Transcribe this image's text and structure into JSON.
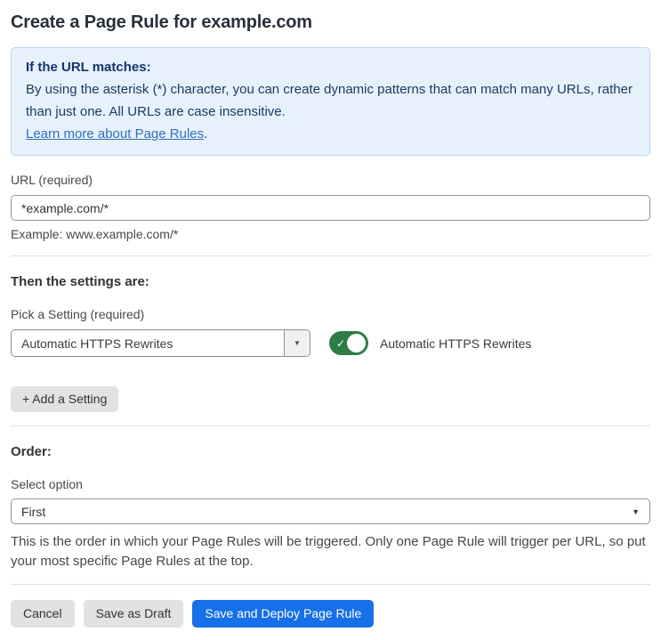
{
  "page": {
    "title": "Create a Page Rule for example.com"
  },
  "info_box": {
    "heading": "If the URL matches:",
    "body": "By using the asterisk (*) character, you can create dynamic patterns that can match many URLs, rather than just one. All URLs are case insensitive.",
    "link_label": "Learn more about Page Rules",
    "link_suffix": "."
  },
  "url_field": {
    "label": "URL (required)",
    "value": "*example.com/*",
    "helper": "Example: www.example.com/*"
  },
  "settings_section": {
    "heading": "Then the settings are:",
    "picker_label": "Pick a Setting (required)",
    "picker_value": "Automatic HTTPS Rewrites",
    "toggle_label": "Automatic HTTPS Rewrites",
    "toggle_state": "on",
    "add_setting_label": "+ Add a Setting"
  },
  "order_section": {
    "heading": "Order:",
    "select_label": "Select option",
    "select_value": "First",
    "helper": "This is the order in which your Page Rules will be triggered. Only one Page Rule will trigger per URL, so put your most specific Page Rules at the top."
  },
  "footer": {
    "cancel_label": "Cancel",
    "save_draft_label": "Save as Draft",
    "save_deploy_label": "Save and Deploy Page Rule"
  },
  "icons": {
    "dropdown_caret": "▼",
    "toggle_check": "✓"
  },
  "colors": {
    "info_bg": "#e7f1fb",
    "info_border": "#b9d8f2",
    "info_text": "#1e3a66",
    "link": "#2f6fc1",
    "toggle_on": "#2e7d46",
    "primary_button": "#1670e8",
    "secondary_button": "#e2e2e2"
  }
}
